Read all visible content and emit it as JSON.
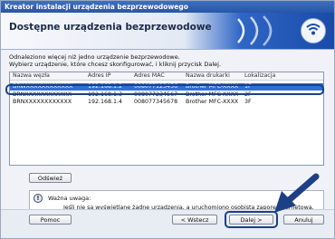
{
  "window": {
    "title": "Kreator instalacji urządzenia bezprzewodowego"
  },
  "header": {
    "title": "Dostępne urządzenia bezprzewodowe",
    "icon": "wifi-icon"
  },
  "intro": {
    "line1": "Odnaleziono więcej niż jedno urządzenie bezprzewodowe.",
    "line2": "Wybierz urządzenie, które chcesz skonfigurować, i kliknij przycisk Dalej."
  },
  "list": {
    "columns": [
      "Nazwa węzła",
      "Adres IP",
      "Adres MAC",
      "Nazwa drukarki",
      "Lokalizacja"
    ],
    "rows": [
      {
        "node": "BRWXXXXXXXXXXXX",
        "ip": "192.168.1.2",
        "mac": "008077123456",
        "printer": "Brother MFC-XXXX",
        "loc": "1F",
        "selected": true
      },
      {
        "node": "BRNXXXXXXXXXXXX",
        "ip": "192.168.1.3",
        "mac": "008077234567",
        "printer": "Brother MFC-XXXX",
        "loc": "2F",
        "selected": false
      },
      {
        "node": "BRNXXXXXXXXXXXX",
        "ip": "192.168.1.4",
        "mac": "008077345678",
        "printer": "Brother MFC-XXXX",
        "loc": "3F",
        "selected": false
      }
    ]
  },
  "refresh_button": "Odśwież",
  "warning": {
    "heading": "Ważna uwaga:",
    "text": "Jeśli nie są wyświetlane żadne urządzenia, a uruchomiono osobistą zaporę internetową, wyłącz zaporę i kliknij przycisk Odśwież, aby ponownie wyszukać sieć bezprzewodową."
  },
  "footer": {
    "help": "Pomoc",
    "back": "< Wstecz",
    "next": "Dalej >",
    "cancel": "Anuluj"
  },
  "colors": {
    "accent": "#2f6fd4",
    "highlight_ring": "#1d3f86",
    "header_blue": "#1a4aa8"
  }
}
